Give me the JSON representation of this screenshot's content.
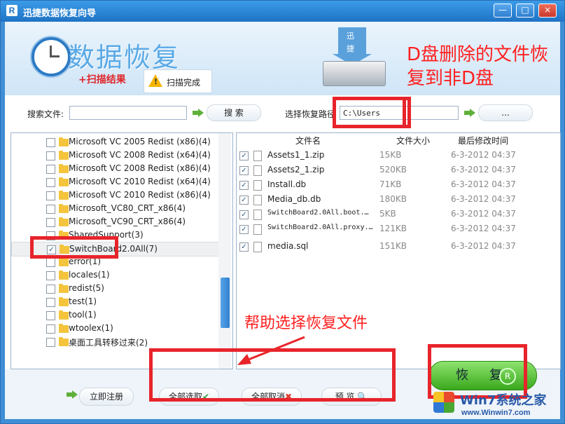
{
  "window": {
    "title": "迅捷数据恢复向导",
    "min_label": "—",
    "max_label": "□",
    "close_label": "×"
  },
  "banner": {
    "title": "数据恢复",
    "scan_result": "+扫描结果",
    "scan_status": "扫描完成",
    "hdd_text_top": "迅",
    "hdd_text_bottom": "捷",
    "annotation_top": [
      "D盘删除的文件恢",
      "复到非D盘"
    ]
  },
  "search": {
    "file_label": "搜索文件:",
    "file_value": "",
    "search_button": "搜 索",
    "path_label": "选择恢复路径",
    "path_value": "C:\\Users",
    "browse_button": "..."
  },
  "tree": {
    "items": [
      {
        "label": "Microsoft VC 2005 Redist (x86)(4)",
        "checked": false
      },
      {
        "label": "Microsoft VC 2008 Redist (x64)(4)",
        "checked": false
      },
      {
        "label": "Microsoft VC 2008 Redist (x86)(4)",
        "checked": false
      },
      {
        "label": "Microsoft VC 2010 Redist (x64)(4)",
        "checked": false
      },
      {
        "label": "Microsoft VC 2010 Redist (x86)(4)",
        "checked": false
      },
      {
        "label": "Microsoft_VC80_CRT_x86(4)",
        "checked": false
      },
      {
        "label": "Microsoft_VC90_CRT_x86(4)",
        "checked": false
      },
      {
        "label": "SharedSupport(3)",
        "checked": false
      },
      {
        "label": "SwitchBoard2.0All(7)",
        "checked": true
      },
      {
        "label": "error(1)",
        "checked": false
      },
      {
        "label": "locales(1)",
        "checked": false
      },
      {
        "label": "redist(5)",
        "checked": false
      },
      {
        "label": "test(1)",
        "checked": false
      },
      {
        "label": "tool(1)",
        "checked": false
      },
      {
        "label": "wtoolex(1)",
        "checked": false
      },
      {
        "label": "桌面工具转移过来(2)",
        "checked": false
      }
    ]
  },
  "files": {
    "headers": {
      "name": "文件名",
      "size": "文件大小",
      "modified": "最后修改时间"
    },
    "rows": [
      {
        "name": "Assets1_1.zip",
        "size": "15KB",
        "modified": "6-3-2012 04:37",
        "checked": true
      },
      {
        "name": "Assets2_1.zip",
        "size": "520KB",
        "modified": "6-3-2012 04:37",
        "checked": true
      },
      {
        "name": "Install.db",
        "size": "71KB",
        "modified": "6-3-2012 04:37",
        "checked": true
      },
      {
        "name": "Media_db.db",
        "size": "180KB",
        "modified": "6-3-2012 04:37",
        "checked": true
      },
      {
        "name": "SwitchBoard2.0All.boot.…",
        "size": "5KB",
        "modified": "6-3-2012 04:37",
        "checked": true
      },
      {
        "name": "SwitchBoard2.0All.proxy.…",
        "size": "121KB",
        "modified": "6-3-2012 04:37",
        "checked": true
      },
      {
        "name": "media.sql",
        "size": "151KB",
        "modified": "6-3-2012 04:37",
        "checked": true
      }
    ]
  },
  "bottom": {
    "register": "立即注册",
    "select_all": "全部选取",
    "cancel_all": "全部取消",
    "preview": "预 览",
    "recover": "恢 复",
    "recover_icon": "R",
    "annotation_help": "帮助选择恢复文件"
  },
  "watermark": {
    "text": "Win7系统之家",
    "url": "www.Winwin7.com"
  },
  "colors": {
    "annotation_red": "#e8242b",
    "title_blue": "#1f73c5",
    "recover_green": "#3aa81c"
  }
}
